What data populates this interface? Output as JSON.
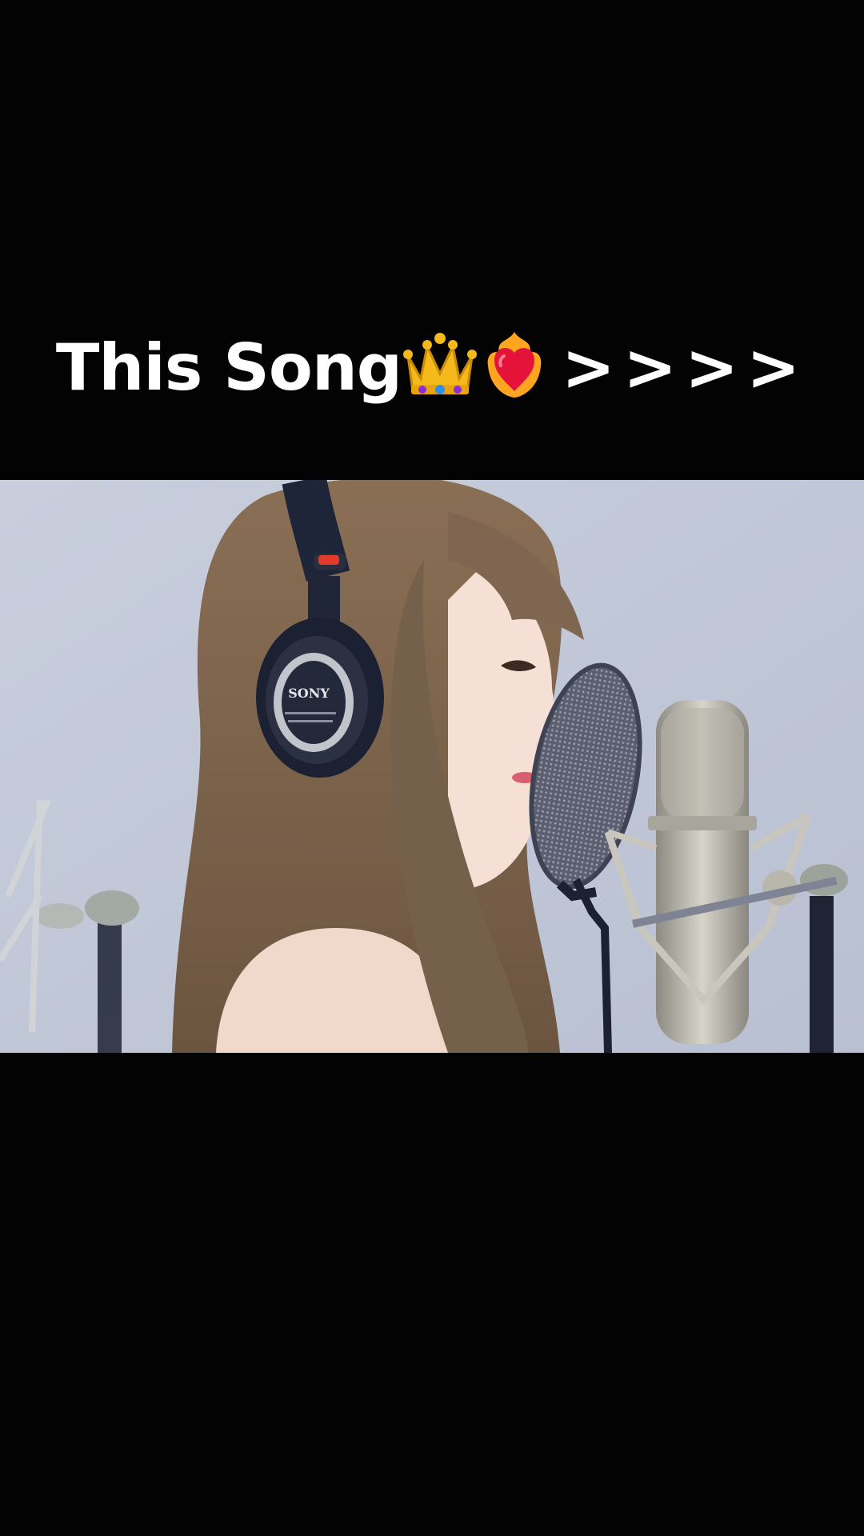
{
  "caption": {
    "text": "This Song",
    "emoji_1": "crown-emoji",
    "emoji_2": "heart-on-fire-emoji",
    "suffix": ">>>>"
  },
  "video_frame": {
    "scene": "singer-with-headphones-at-studio-microphone",
    "headphone_brand": "SONY"
  },
  "colors": {
    "background": "#030304",
    "caption_text": "#ffffff",
    "studio_wall": "#c3c9d8"
  }
}
